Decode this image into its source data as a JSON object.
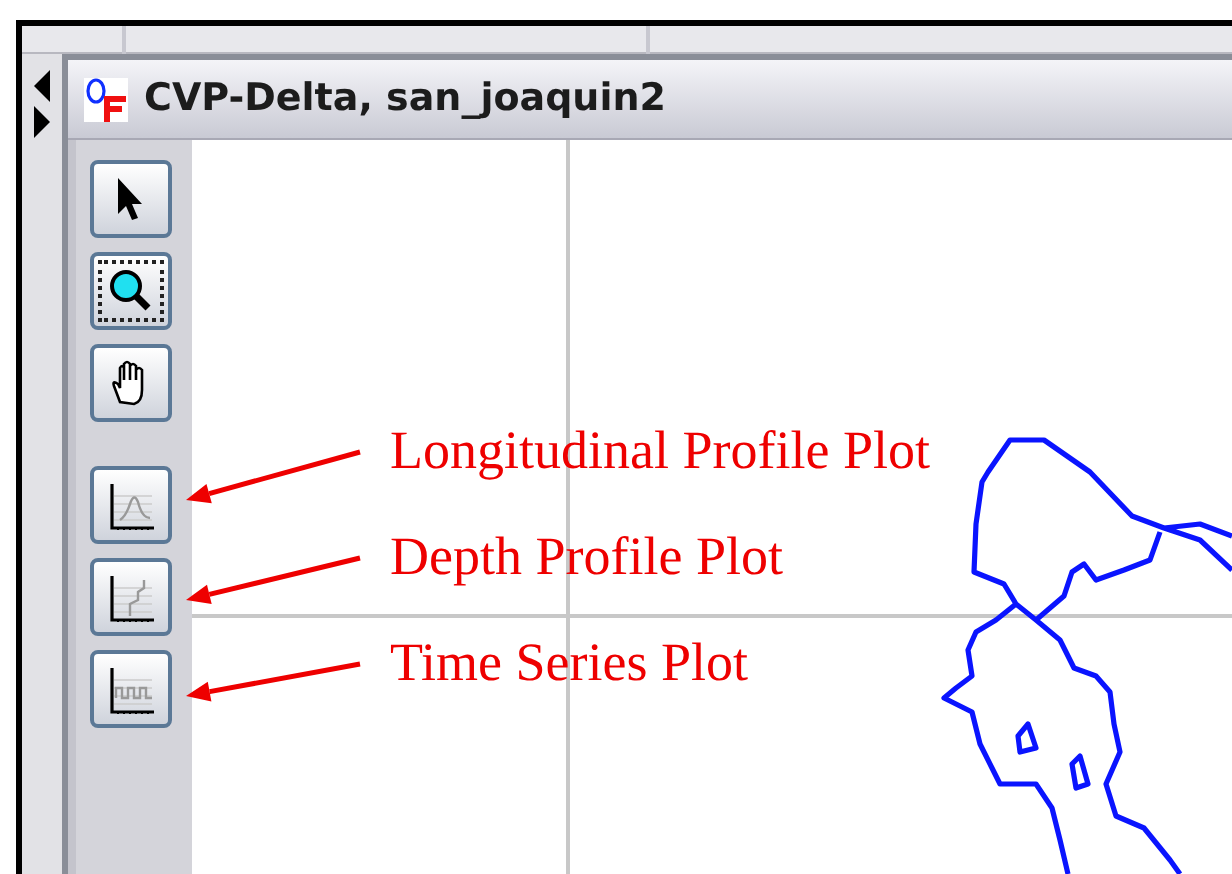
{
  "window": {
    "title": "CVP-Delta, san_joaquin2"
  },
  "navigation_tools": [
    {
      "kind": "pointer",
      "selected": false
    },
    {
      "kind": "zoom",
      "selected": true
    },
    {
      "kind": "pan",
      "selected": false
    }
  ],
  "plot_tools": [
    {
      "kind": "longitudinal"
    },
    {
      "kind": "depth"
    },
    {
      "kind": "time_series"
    }
  ],
  "annotations": [
    {
      "label": "Longitudinal Profile Plot"
    },
    {
      "label": "Depth Profile Plot"
    },
    {
      "label": "Time Series Plot"
    }
  ]
}
